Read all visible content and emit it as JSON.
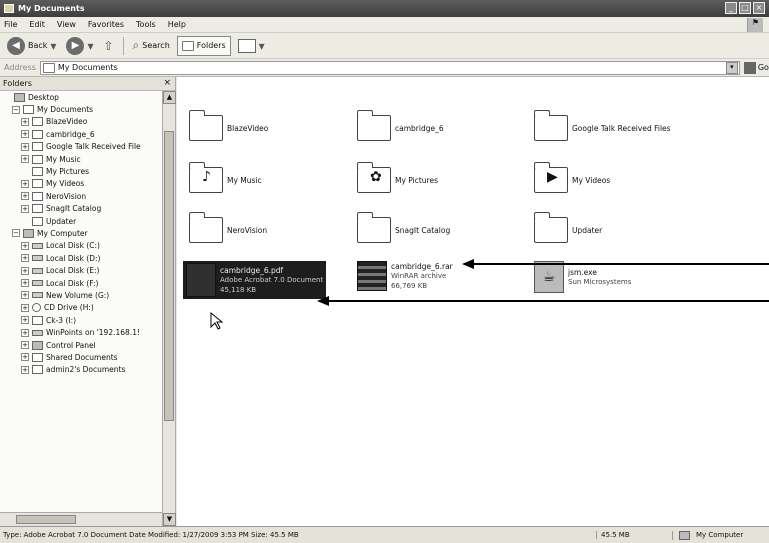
{
  "window": {
    "title": "My Documents"
  },
  "menu": [
    "File",
    "Edit",
    "View",
    "Favorites",
    "Tools",
    "Help"
  ],
  "toolbar": {
    "back_label": "Back",
    "search_label": "Search",
    "folders_label": "Folders"
  },
  "address": {
    "label": "Address",
    "value": "My Documents",
    "go_label": "Go"
  },
  "folders_pane": {
    "title": "Folders",
    "tree": [
      {
        "label": "Desktop",
        "level": 0
      },
      {
        "label": "My Documents",
        "level": 1
      },
      {
        "label": "BlazeVideo",
        "level": 2
      },
      {
        "label": "cambridge_6",
        "level": 2
      },
      {
        "label": "Google Talk Received File",
        "level": 2
      },
      {
        "label": "My Music",
        "level": 2
      },
      {
        "label": "My Pictures",
        "level": 2
      },
      {
        "label": "My Videos",
        "level": 2
      },
      {
        "label": "NeroVision",
        "level": 2
      },
      {
        "label": "SnagIt Catalog",
        "level": 2
      },
      {
        "label": "Updater",
        "level": 2
      },
      {
        "label": "My Computer",
        "level": 1
      },
      {
        "label": "Local Disk (C:)",
        "level": 2
      },
      {
        "label": "Local Disk (D:)",
        "level": 2
      },
      {
        "label": "Local Disk (E:)",
        "level": 2
      },
      {
        "label": "Local Disk (F:)",
        "level": 2
      },
      {
        "label": "New Volume (G:)",
        "level": 2
      },
      {
        "label": "CD Drive (H:)",
        "level": 2
      },
      {
        "label": "Ck-3 (I:)",
        "level": 2
      },
      {
        "label": "WinPoints on '192.168.1!",
        "level": 2
      },
      {
        "label": "Control Panel",
        "level": 2
      },
      {
        "label": "Shared Documents",
        "level": 2
      },
      {
        "label": "admin2's Documents",
        "level": 2
      }
    ]
  },
  "content": {
    "folders": [
      {
        "label": "BlazeVideo",
        "icon": "folder-icon"
      },
      {
        "label": "cambridge_6",
        "icon": "folder-icon"
      },
      {
        "label": "Google Talk Received Files",
        "icon": "folder-icon"
      },
      {
        "label": "My Music",
        "icon": "music-folder-icon"
      },
      {
        "label": "My Pictures",
        "icon": "pictures-folder-icon"
      },
      {
        "label": "My Videos",
        "icon": "videos-folder-icon"
      },
      {
        "label": "NeroVision",
        "icon": "folder-icon"
      },
      {
        "label": "SnagIt Catalog",
        "icon": "folder-icon"
      },
      {
        "label": "Updater",
        "icon": "folder-icon"
      }
    ],
    "files": [
      {
        "name": "cambridge_6.pdf",
        "type": "Adobe Acrobat 7.0 Document",
        "size": "45,118 KB",
        "icon": "pdf-icon",
        "selected": true
      },
      {
        "name": "cambridge_6.rar",
        "type": "WinRAR archive",
        "size": "66,769 KB",
        "icon": "rar-archive-icon",
        "selected": false
      },
      {
        "name": "jsm.exe",
        "type": "Sun Microsystems",
        "size": "",
        "icon": "java-icon",
        "selected": false
      }
    ]
  },
  "statusbar": {
    "text": "Type: Adobe Acrobat 7.0 Document Date Modified: 1/27/2009 3:53 PM Size: 45.5 MB",
    "size": "45.5 MB",
    "zone": "My Computer"
  }
}
